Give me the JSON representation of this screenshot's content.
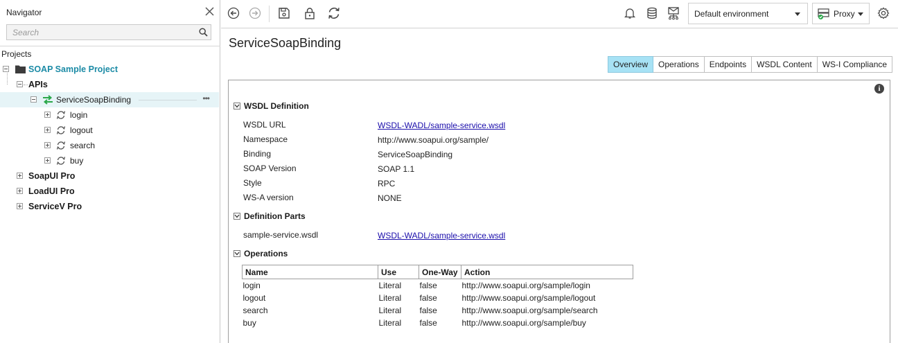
{
  "navigator": {
    "title": "Navigator",
    "search_placeholder": "Search",
    "projects_label": "Projects",
    "tree": {
      "project": "SOAP Sample Project",
      "apis": "APIs",
      "binding": "ServiceSoapBinding",
      "operations": [
        "login",
        "logout",
        "search",
        "buy"
      ],
      "others": [
        "SoapUI Pro",
        "LoadUI Pro",
        "ServiceV Pro"
      ]
    }
  },
  "toolbar": {
    "environment": "Default environment",
    "proxy": "Proxy"
  },
  "main": {
    "title": "ServiceSoapBinding",
    "tabs": [
      "Overview",
      "Operations",
      "Endpoints",
      "WSDL Content",
      "WS-I Compliance"
    ],
    "active_tab": "Overview",
    "wsdl_definition": {
      "heading": "WSDL Definition",
      "rows": [
        {
          "label": "WSDL URL",
          "value": "WSDL-WADL/sample-service.wsdl"
        },
        {
          "label": "Namespace",
          "value": "http://www.soapui.org/sample/"
        },
        {
          "label": "Binding",
          "value": "ServiceSoapBinding"
        },
        {
          "label": "SOAP Version",
          "value": "SOAP 1.1"
        },
        {
          "label": "Style",
          "value": "RPC"
        },
        {
          "label": "WS-A version",
          "value": "NONE"
        }
      ]
    },
    "definition_parts": {
      "heading": "Definition Parts",
      "rows": [
        {
          "label": "sample-service.wsdl",
          "value": "WSDL-WADL/sample-service.wsdl"
        }
      ]
    },
    "operations": {
      "heading": "Operations",
      "columns": [
        "Name",
        "Use",
        "One-Way",
        "Action"
      ],
      "rows": [
        [
          "login",
          "Literal",
          "false",
          "http://www.soapui.org/sample/login"
        ],
        [
          "logout",
          "Literal",
          "false",
          "http://www.soapui.org/sample/logout"
        ],
        [
          "search",
          "Literal",
          "false",
          "http://www.soapui.org/sample/search"
        ],
        [
          "buy",
          "Literal",
          "false",
          "http://www.soapui.org/sample/buy"
        ]
      ]
    }
  },
  "colors": {
    "accent": "#1c8ba6",
    "active_tab": "#a7e2f5",
    "link": "#1a0dab",
    "selection": "#e6f4f7",
    "binding_icon": "#2aa84a"
  }
}
